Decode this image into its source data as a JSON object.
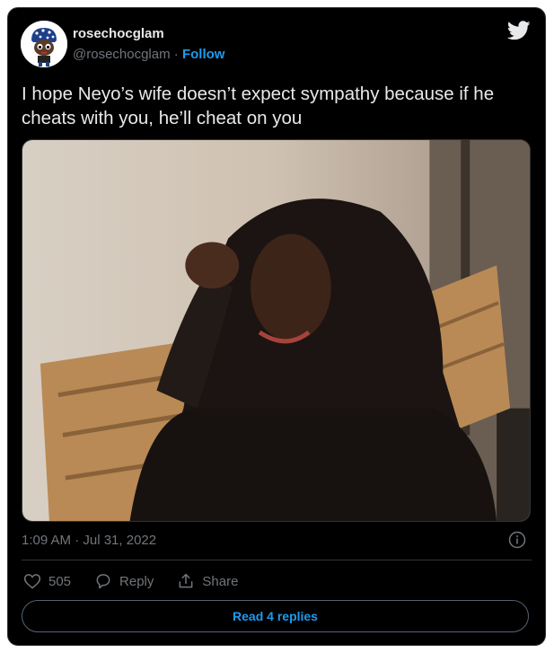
{
  "author": {
    "display_name": "rosechocglam",
    "handle": "@rosechocglam",
    "separator": "·",
    "follow_label": "Follow"
  },
  "tweet": {
    "text": "I hope Neyo’s wife doesn’t expect sympathy because if he cheats with you, he’ll cheat on you",
    "timestamp": "1:09 AM · Jul 31, 2022"
  },
  "actions": {
    "likes_count": "505",
    "reply_label": "Reply",
    "share_label": "Share"
  },
  "read_replies_label": "Read 4 replies",
  "icons": {
    "brand": "twitter-bird-icon",
    "info": "info-icon",
    "like": "heart-icon",
    "reply": "reply-bubble-icon",
    "share": "share-icon"
  },
  "colors": {
    "background": "#000000",
    "text": "#e7e9ea",
    "secondary_text": "#71767b",
    "accent": "#1d9bf0",
    "border": "#2f3336"
  }
}
